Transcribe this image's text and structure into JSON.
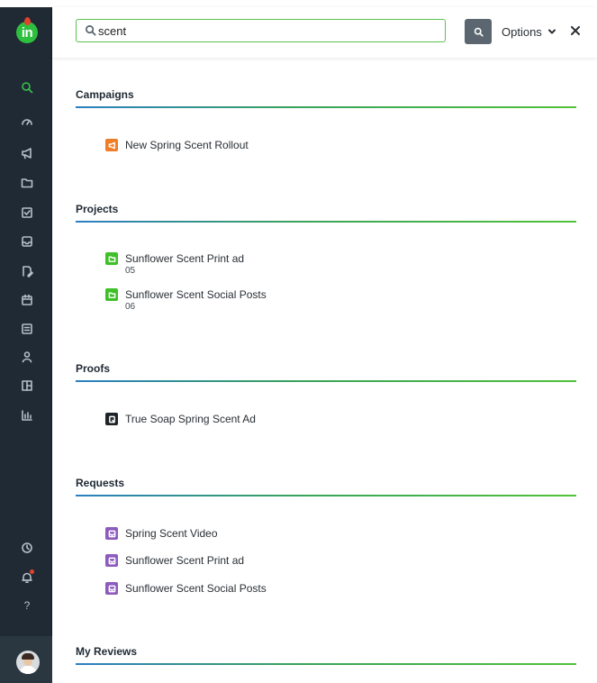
{
  "search": {
    "query": "scent"
  },
  "header": {
    "options_label": "Options"
  },
  "sections": {
    "campaigns": {
      "title": "Campaigns",
      "items": [
        {
          "label": "New Spring Scent Rollout",
          "icon": "megaphone-icon",
          "color": "#f07d28"
        }
      ]
    },
    "projects": {
      "title": "Projects",
      "items": [
        {
          "label": "Sunflower Scent Print ad",
          "sub": "05",
          "icon": "folder-icon",
          "color": "#3fc028"
        },
        {
          "label": "Sunflower Scent Social Posts",
          "sub": "06",
          "icon": "folder-icon",
          "color": "#3fc028"
        }
      ]
    },
    "proofs": {
      "title": "Proofs",
      "items": [
        {
          "label": "True Soap Spring Scent Ad",
          "icon": "proof-icon",
          "color": "#1f2428"
        }
      ]
    },
    "requests": {
      "title": "Requests",
      "items": [
        {
          "label": "Spring Scent Video",
          "icon": "inbox-icon",
          "color": "#8d5bbf"
        },
        {
          "label": "Sunflower Scent Print ad",
          "icon": "inbox-icon",
          "color": "#8d5bbf"
        },
        {
          "label": "Sunflower Scent Social Posts",
          "icon": "inbox-icon",
          "color": "#8d5bbf"
        }
      ]
    },
    "reviews": {
      "title": "My Reviews"
    }
  },
  "sidebar": {
    "logo_text": "in",
    "help_label": "?",
    "icons": [
      "search-icon",
      "dashboard-icon",
      "megaphone-icon",
      "folder-icon",
      "checkbox-icon",
      "inbox-icon",
      "proof-edit-icon",
      "calendar-icon",
      "checklist-icon",
      "person-icon",
      "layout-icon",
      "chart-icon",
      "clock-icon",
      "bell-icon",
      "help-icon"
    ]
  },
  "colors": {
    "accent": "#3fc028",
    "sidebar": "#1f2a34",
    "rule_start": "#2c7fc3",
    "rule_end": "#52c13a"
  }
}
